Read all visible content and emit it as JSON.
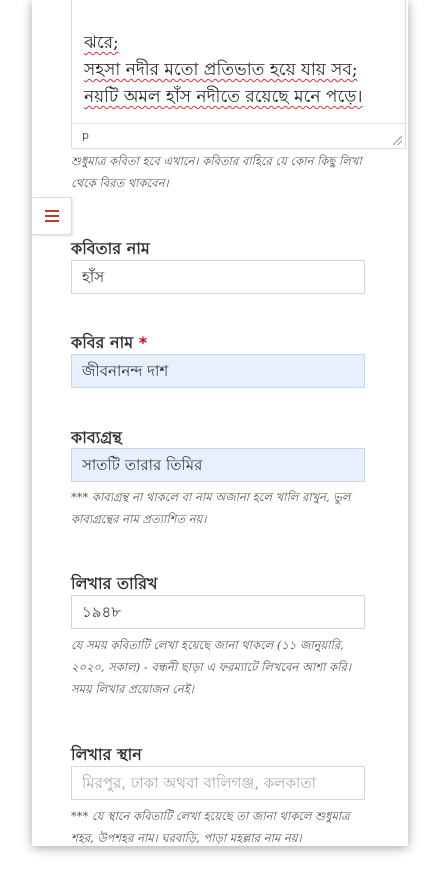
{
  "editor": {
    "poem_lines": [
      "ঝরে;",
      "সহসা নদীর মতো প্রতিভাত হয়ে যায় সব;",
      "নয়টি অমল হাঁস নদীতে রয়েছে মনে পড়ে।"
    ],
    "status_path": "p"
  },
  "poem_hint": "শুধুমাত্র কবিতা হবে এখানে। কবিতার বাহিরে যে কোন কিছু লিখা থেকে বিরত থাকবেন।",
  "menu": {
    "icon": "hamburger-menu-icon",
    "color": "#c0392b"
  },
  "fields": {
    "title": {
      "label": "কবিতার নাম",
      "value": "হাঁস"
    },
    "poet": {
      "label": "কবির নাম",
      "required_mark": "*",
      "value": "জীবনানন্দ দাশ"
    },
    "book": {
      "label": "কাব্যগ্রন্থ",
      "value": "সাতটি তারার তিমির",
      "hint": "*** কাব্যগ্রন্থ না থাকলে বা নাম অজানা হলে খালি রাখুন, ভুল কাব্যগ্রন্থের নাম প্রত্যাশিত নয়।"
    },
    "date": {
      "label": "লিখার তারিখ",
      "value": "১৯৪৮",
      "hint": "যে সময় কবিতাটি লেখা হয়েছে জানা থাকলে (১১ জানুয়ারি, ২০২০, সকাল) - বন্ধনী ছাড়া এ ফরম্যাটে লিখবেন আশা করি। সময় লিখার প্রয়োজন নেই।"
    },
    "place": {
      "label": "লিখার স্থান",
      "placeholder": "মিরপুর, ঢাকা অথবা বালিগঞ্জ, কলকাতা",
      "hint": "*** যে স্থানে কবিতাটি লেখা হয়েছে তা জানা থাকলে শুধুমাত্র শহর, উপশহর নাম। ঘরবাড়ি, পাড়া মহল্লার নাম নয়।"
    }
  }
}
